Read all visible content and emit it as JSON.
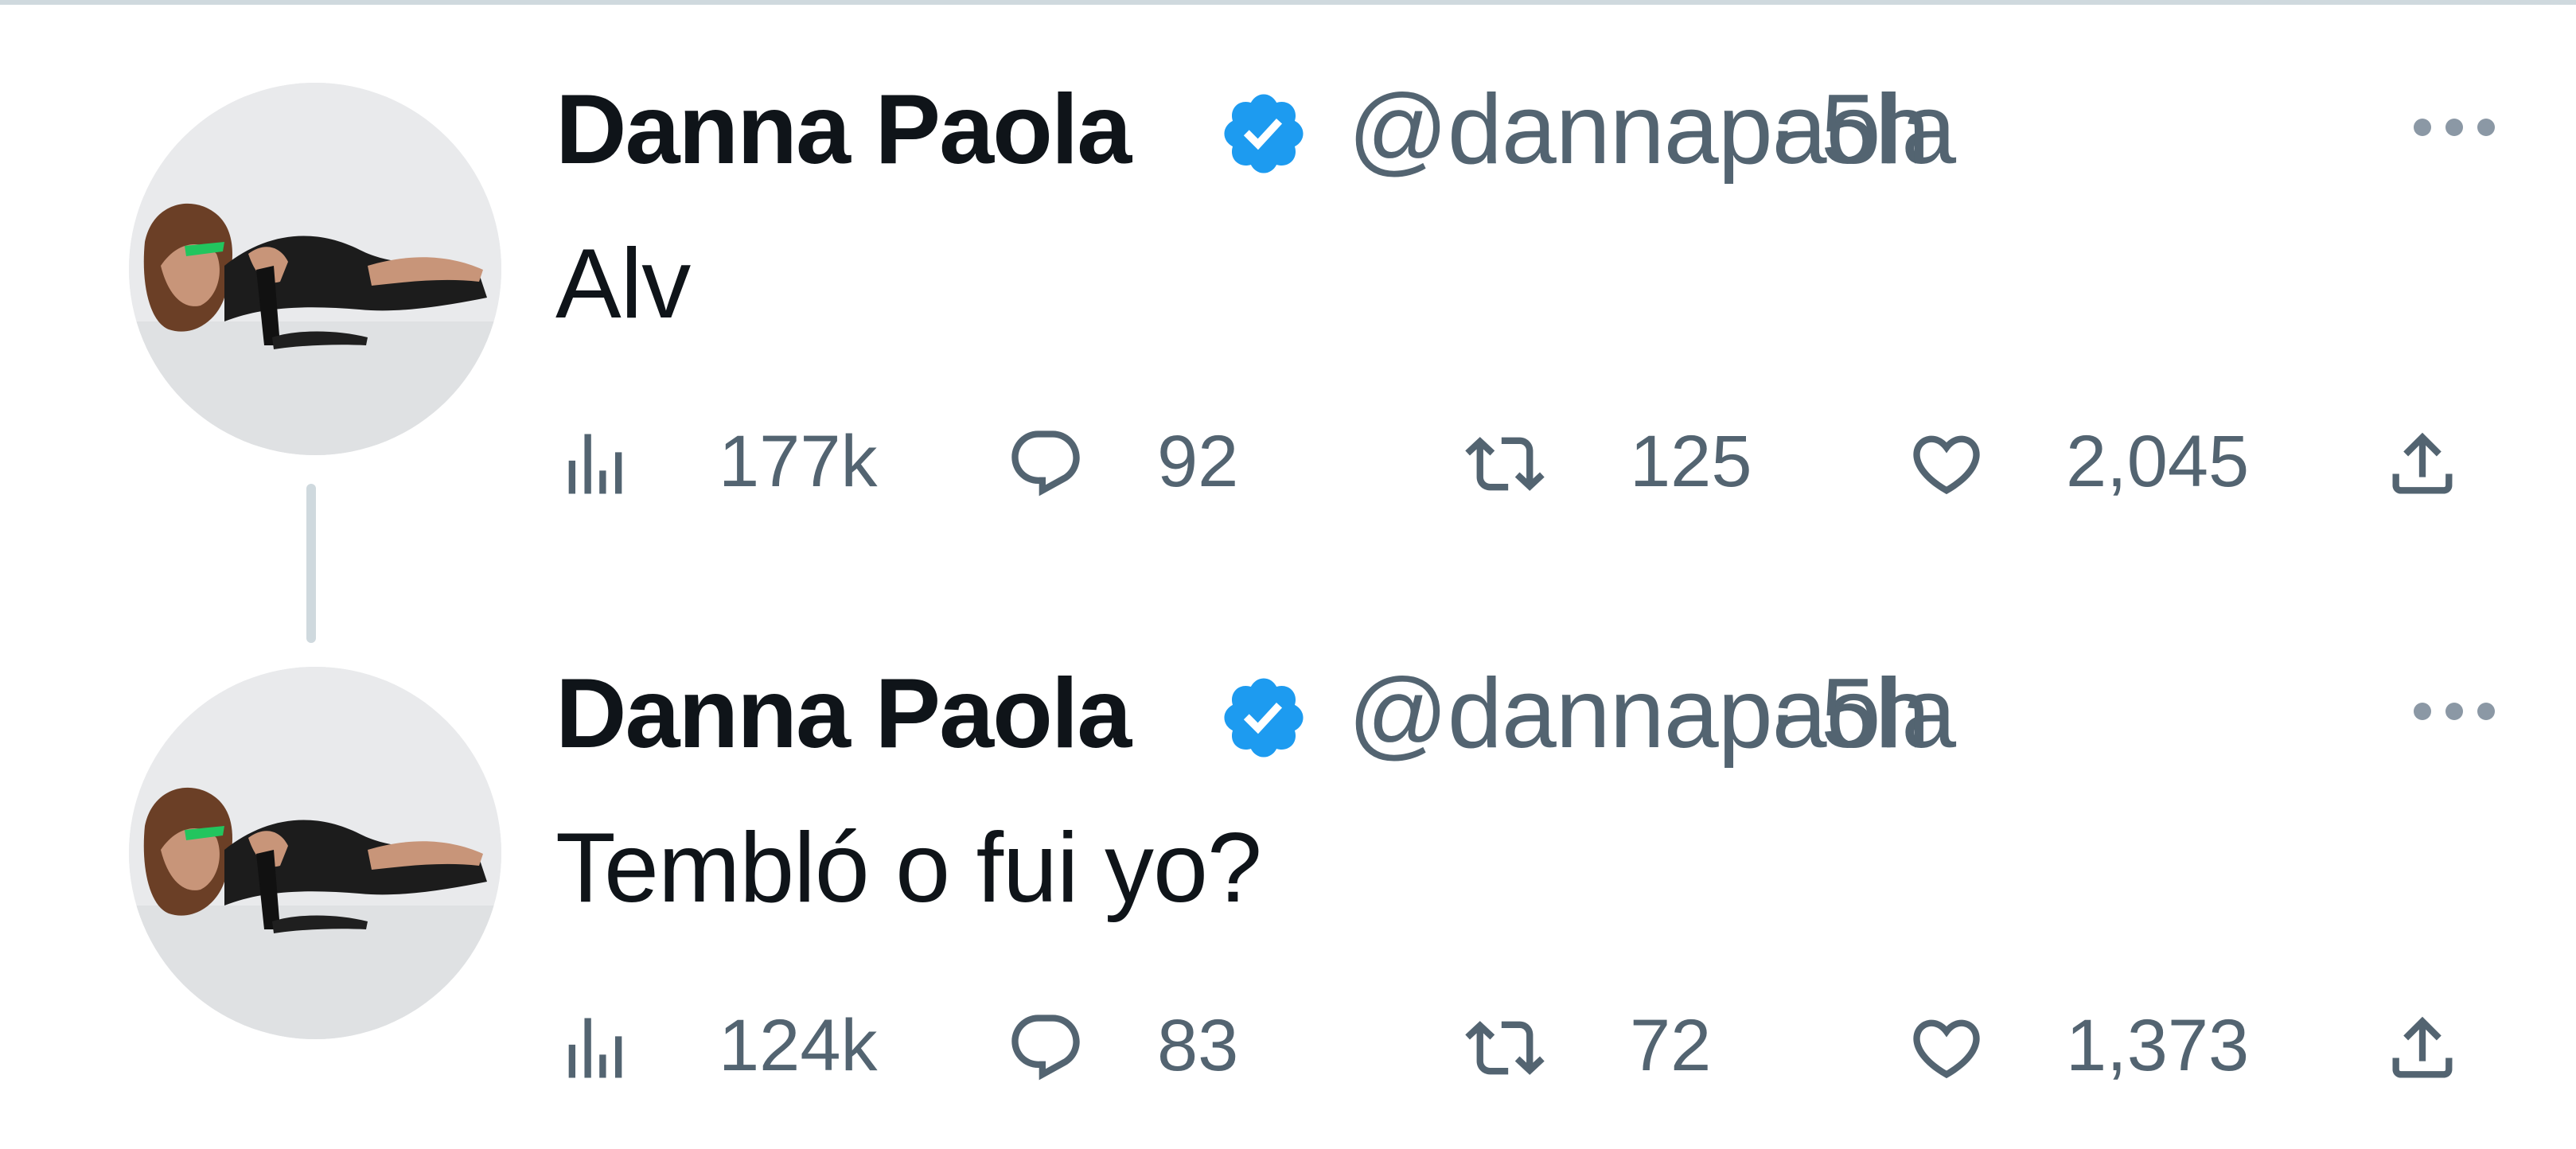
{
  "colors": {
    "text": "#0f1419",
    "secondary": "#536471",
    "verified": "#1d9bf0",
    "divider": "#cfd9de"
  },
  "tweets": [
    {
      "display_name": "Danna Paola",
      "handle": "@dannapaola",
      "separator": "·",
      "time": "5h",
      "text": "Alv",
      "views": "177k",
      "replies": "92",
      "retweets": "125",
      "likes": "2,045"
    },
    {
      "display_name": "Danna Paola",
      "handle": "@dannapaola",
      "separator": "·",
      "time": "5h",
      "text": "Tembló o fui yo?",
      "views": "124k",
      "replies": "83",
      "retweets": "72",
      "likes": "1,373"
    }
  ],
  "icons": [
    "verified-badge-icon",
    "more-icon",
    "views-icon",
    "reply-icon",
    "retweet-icon",
    "like-icon",
    "share-icon"
  ]
}
